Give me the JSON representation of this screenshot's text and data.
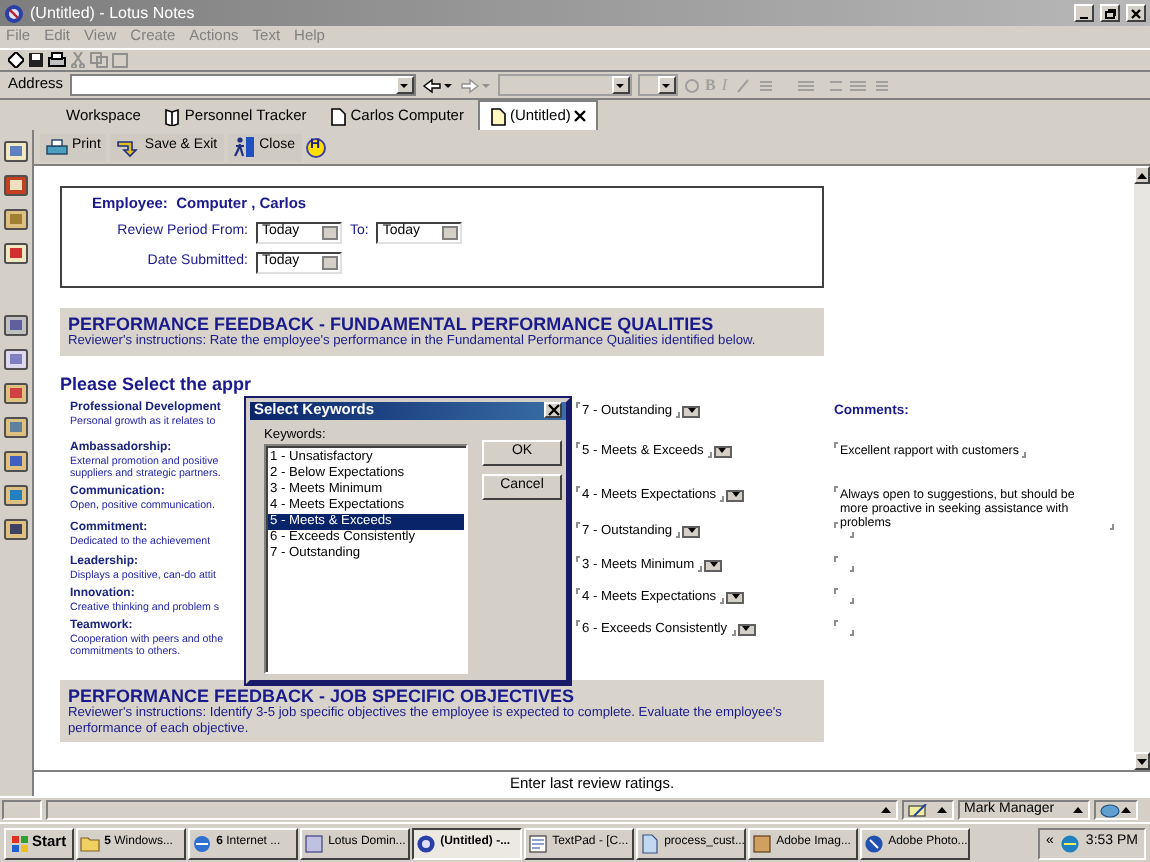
{
  "window": {
    "title": "(Untitled) - Lotus Notes"
  },
  "menu": [
    "File",
    "Edit",
    "View",
    "Create",
    "Actions",
    "Text",
    "Help"
  ],
  "address_bar": {
    "label": "Address"
  },
  "format_toolbar": [
    "B",
    "I"
  ],
  "tabs": [
    {
      "label": "Workspace",
      "kind": "workspace",
      "selected": false
    },
    {
      "label": "Personnel Tracker",
      "kind": "database",
      "selected": false
    },
    {
      "label": "Carlos Computer",
      "kind": "document",
      "selected": false
    },
    {
      "label": "(Untitled)",
      "kind": "document",
      "selected": true
    }
  ],
  "action_bar": [
    {
      "label": "Print",
      "kind": "print"
    },
    {
      "label": "Save & Exit",
      "kind": "save"
    },
    {
      "label": "Close",
      "kind": "close"
    },
    {
      "label": "H",
      "kind": "help"
    }
  ],
  "employee": {
    "label": "Employee:",
    "name": "Computer , Carlos"
  },
  "review_period": {
    "from_label": "Review Period From:",
    "from_value": "Today",
    "to_label": "To:",
    "to_value": "Today"
  },
  "date_submitted": {
    "label": "Date Submitted:",
    "value": "Today"
  },
  "sections": [
    {
      "title": "PERFORMANCE FEEDBACK - FUNDAMENTAL PERFORMANCE QUALITIES",
      "instructions": "Reviewer's instructions: Rate the employee's performance in the Fundamental Performance Qualities identified below."
    },
    {
      "title": "PERFORMANCE FEEDBACK - JOB SPECIFIC OBJECTIVES",
      "instructions": "Reviewer's instructions: Identify 3-5 job specific objectives the employee is expected to complete. Evaluate the employee's performance of each objective."
    }
  ],
  "ratings_heading": "Please Select the appr",
  "comments_heading": "Comments:",
  "qualities": [
    {
      "title": "Professional Development",
      "description": [
        "Personal growth as it relates to"
      ],
      "rating": "7 - Outstanding"
    },
    {
      "title": "Ambassadorship:",
      "description": [
        "External promotion and positive",
        "suppliers and strategic partners."
      ],
      "rating": "5 - Meets & Exceeds",
      "comment": "Excellent rapport with customers"
    },
    {
      "title": "Communication:",
      "description": [
        "Open, positive communication."
      ],
      "rating": "4 - Meets Expectations",
      "comment": "Always open to suggestions, but should be more proactive in seeking assistance with problems"
    },
    {
      "title": "Commitment:",
      "description": [
        "Dedicated to the achievement"
      ],
      "rating": "7 - Outstanding"
    },
    {
      "title": "Leadership:",
      "description": [
        "Displays a positive, can-do attit"
      ],
      "rating": "3 - Meets Minimum"
    },
    {
      "title": "Innovation:",
      "description": [
        "Creative thinking and problem s"
      ],
      "rating": "4 - Meets Expectations"
    },
    {
      "title": "Teamwork:",
      "description": [
        "Cooperation with peers and othe",
        "commitments to others."
      ],
      "rating": "6 - Exceeds Consistently"
    }
  ],
  "dialog": {
    "title": "Select Keywords",
    "list_label": "Keywords:",
    "items": [
      {
        "label": "1 - Unsatisfactory",
        "selected": false
      },
      {
        "label": "2 - Below Expectations",
        "selected": false
      },
      {
        "label": "3 - Meets Minimum",
        "selected": false
      },
      {
        "label": "4 - Meets Expectations",
        "selected": false
      },
      {
        "label": "5 - Meets & Exceeds",
        "selected": true
      },
      {
        "label": "6 - Exceeds Consistently",
        "selected": false
      },
      {
        "label": "7 - Outstanding",
        "selected": false
      }
    ],
    "buttons": [
      "OK",
      "Cancel"
    ]
  },
  "status": {
    "message": "Enter last review ratings.",
    "user": "Mark Manager"
  },
  "taskbar": {
    "start": "Start",
    "tasks": [
      {
        "label": "**5** Windows...",
        "kind": "folder",
        "selected": false
      },
      {
        "label": "**6** Internet ...",
        "kind": "browser",
        "selected": false
      },
      {
        "label": "Lotus Domin...",
        "kind": "server",
        "selected": false
      },
      {
        "label": "(Untitled) -...",
        "kind": "notes",
        "selected": true
      },
      {
        "label": "TextPad - [C...",
        "kind": "editor",
        "selected": false
      },
      {
        "label": "process_cust...",
        "kind": "file",
        "selected": false
      },
      {
        "label": "Adobe Imag...",
        "kind": "image",
        "selected": false
      },
      {
        "label": "Adobe Photo...",
        "kind": "photo",
        "selected": false
      }
    ],
    "tray_toggle": "«",
    "clock": "3:53 PM"
  }
}
